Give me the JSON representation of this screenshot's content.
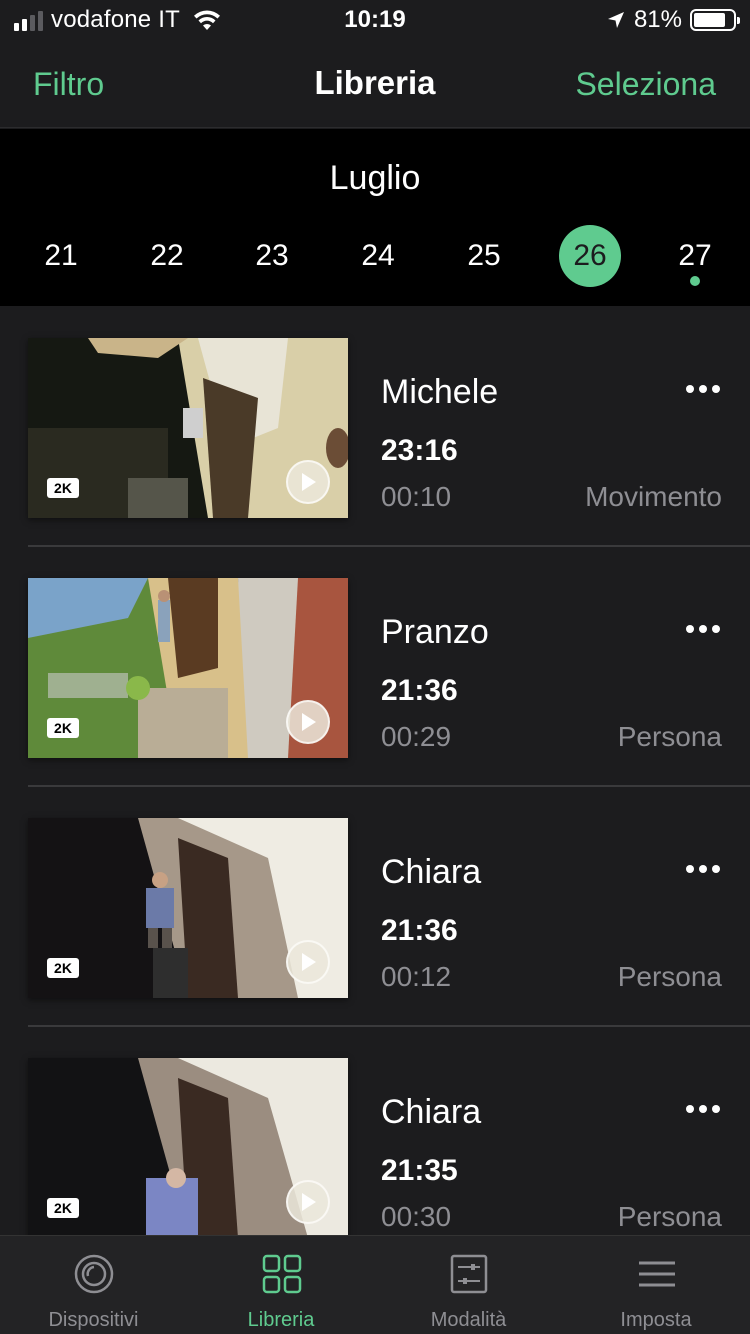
{
  "status_bar": {
    "carrier": "vodafone IT",
    "time": "10:19",
    "battery": "81%",
    "battery_level": 0.81,
    "signal_bars": 2
  },
  "nav": {
    "left": "Filtro",
    "title": "Libreria",
    "right": "Seleziona"
  },
  "calendar": {
    "month": "Luglio",
    "days": [
      "21",
      "22",
      "23",
      "24",
      "25",
      "26",
      "27"
    ],
    "selected": "26",
    "has_dot": "27"
  },
  "badge": "2K",
  "recordings": [
    {
      "title": "Michele",
      "time": "23:16",
      "duration": "00:10",
      "type": "Movimento",
      "scene": "night-porch"
    },
    {
      "title": "Pranzo",
      "time": "21:36",
      "duration": "00:29",
      "type": "Persona",
      "scene": "day-garden"
    },
    {
      "title": "Chiara",
      "time": "21:36",
      "duration": "00:12",
      "type": "Persona",
      "scene": "dusk-person"
    },
    {
      "title": "Chiara",
      "time": "21:35",
      "duration": "00:30",
      "type": "Persona",
      "scene": "dusk-person-2"
    }
  ],
  "tabs": [
    {
      "label": "Dispositivi",
      "icon": "camera-ring-icon"
    },
    {
      "label": "Libreria",
      "icon": "grid-icon"
    },
    {
      "label": "Modalità",
      "icon": "sliders-icon"
    },
    {
      "label": "Imposta",
      "icon": "menu-icon"
    }
  ],
  "active_tab": "Libreria",
  "colors": {
    "accent": "#5fcb8f",
    "background": "#1c1c1e",
    "calendar_bg": "#000000",
    "secondary_text": "#8e8e93"
  }
}
